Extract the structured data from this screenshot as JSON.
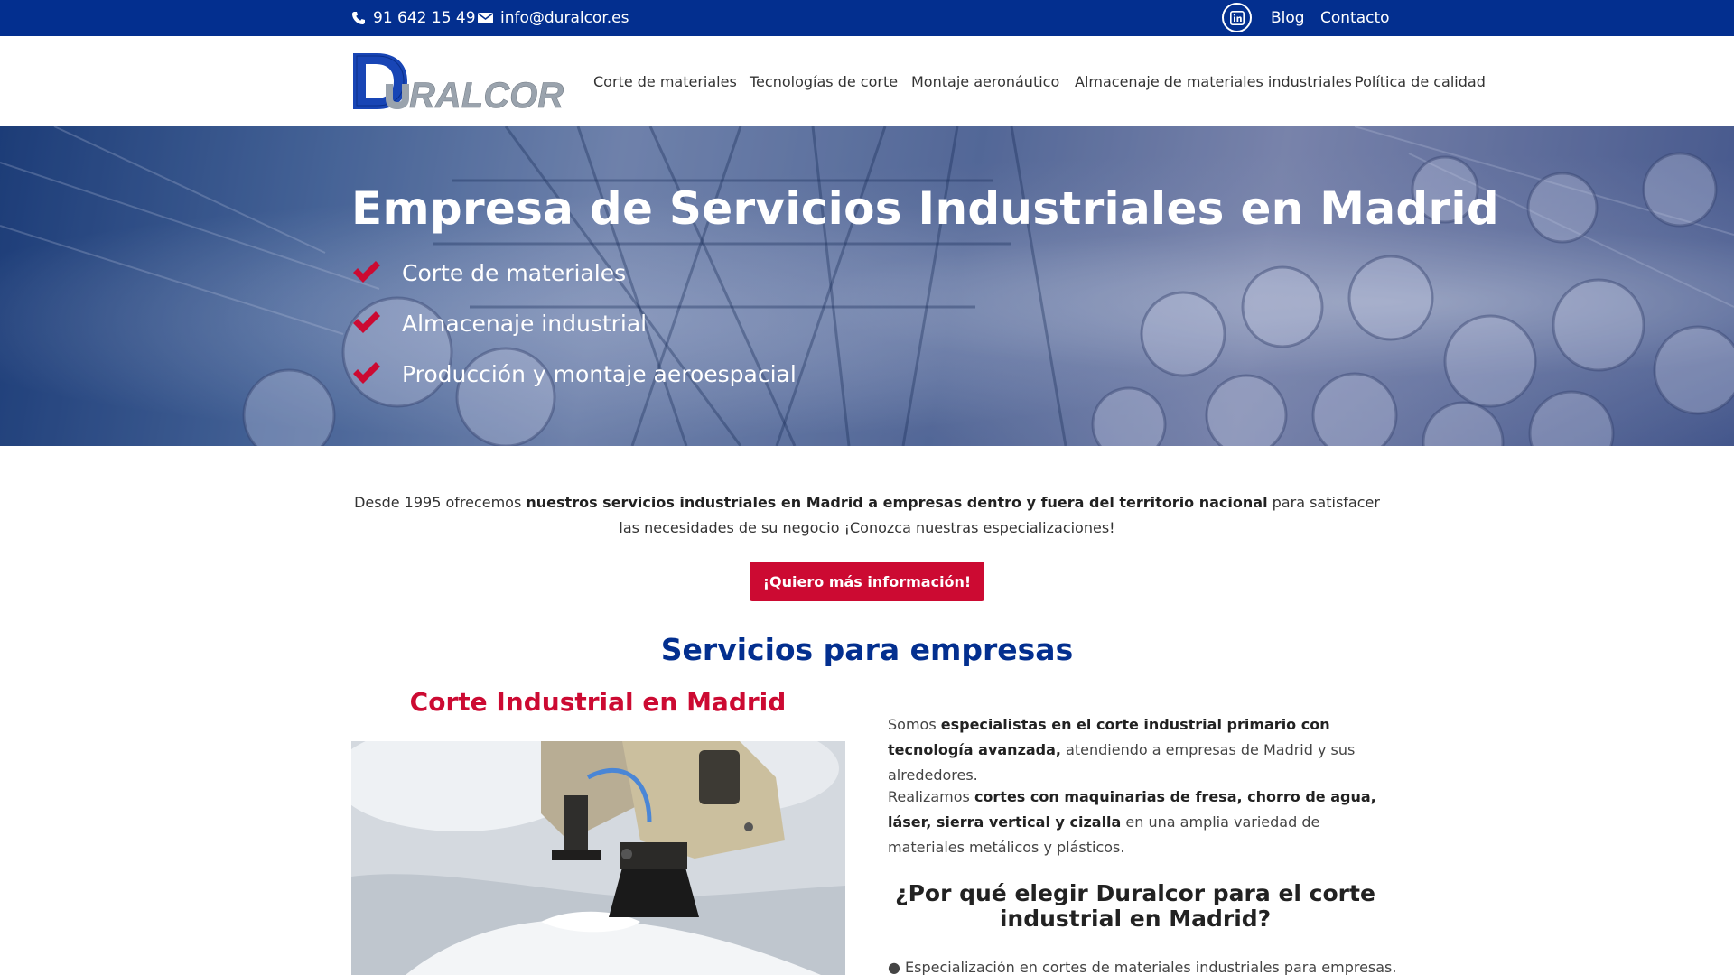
{
  "topbar": {
    "phone": "91 642 15 49",
    "email": "info@duralcor.es",
    "links": [
      "Blog",
      "Contacto"
    ],
    "icons": [
      "phone-icon",
      "envelope-icon",
      "linkedin-icon"
    ]
  },
  "header": {
    "logo_text": "DURALCOR",
    "nav": [
      "Corte de materiales",
      "Tecnologías de corte",
      "Montaje aeronáutico",
      "Almacenaje de materiales industriales",
      "Política de calidad"
    ]
  },
  "hero": {
    "title": "Empresa de Servicios Industriales en Madrid",
    "items": [
      "Corte de materiales",
      "Almacenaje industrial",
      "Producción y montaje aeroespacial"
    ]
  },
  "intro": {
    "text_1": "Desde 1995 ofrecemos ",
    "bold_1": "nuestros servicios industriales en Madrid a empresas dentro y fuera del territorio nacional",
    "text_2": " para satisfacer las necesidades de su negocio ¡Conozca nuestras especializaciones!",
    "cta": "¡Quiero más información!"
  },
  "services": {
    "title": "Servicios para empresas",
    "subtitle": "Corte Industrial en Madrid",
    "p1_text_1": "Somos ",
    "p1_bold": "especialistas en el corte industrial primario con tecnología avanzada,",
    "p1_text_2": " atendiendo a empresas de Madrid y sus alrededores.",
    "p2_text_1": "Realizamos ",
    "p2_bold": "cortes con maquinarias de fresa, chorro de agua, láser, sierra vertical y cizalla",
    "p2_text_2": " en una amplia variedad de materiales metálicos y plásticos.",
    "why_title": "¿Por qué elegir Duralcor para el corte industrial en Madrid?",
    "bullet_1": "● Especialización en cortes de materiales industriales para empresas."
  },
  "colors": {
    "brand_blue": "#032f8f",
    "accent_red": "#cc0a32"
  }
}
